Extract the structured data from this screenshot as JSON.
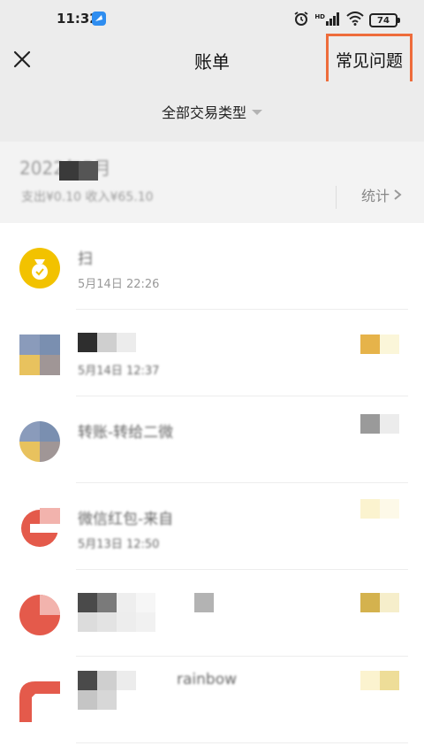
{
  "status_bar": {
    "time": "11:32",
    "battery": "74",
    "network_label": "HD"
  },
  "header": {
    "title": "账单",
    "faq_label": "常见问题"
  },
  "filter": {
    "label": "全部交易类型"
  },
  "month": {
    "label": "2022年5月",
    "summary": "支出¥0.10 收入¥65.10",
    "stats_label": "统计"
  },
  "transactions": [
    {
      "title": "扫",
      "date": "5月14日 22:26"
    },
    {
      "title": "",
      "date": "5月14日 12:37"
    },
    {
      "title": "转账-转给二微",
      "date": ""
    },
    {
      "title": "微信红包-来自",
      "date": "5月13日 12:50"
    },
    {
      "title": "",
      "date": ""
    },
    {
      "title": "rainbow",
      "date": ""
    }
  ],
  "colors": {
    "accent_orange": "#ee6c3b",
    "header_bg": "#ececec",
    "money_bag_yellow": "#f2c200",
    "red_avatar": "#e45a4b"
  }
}
